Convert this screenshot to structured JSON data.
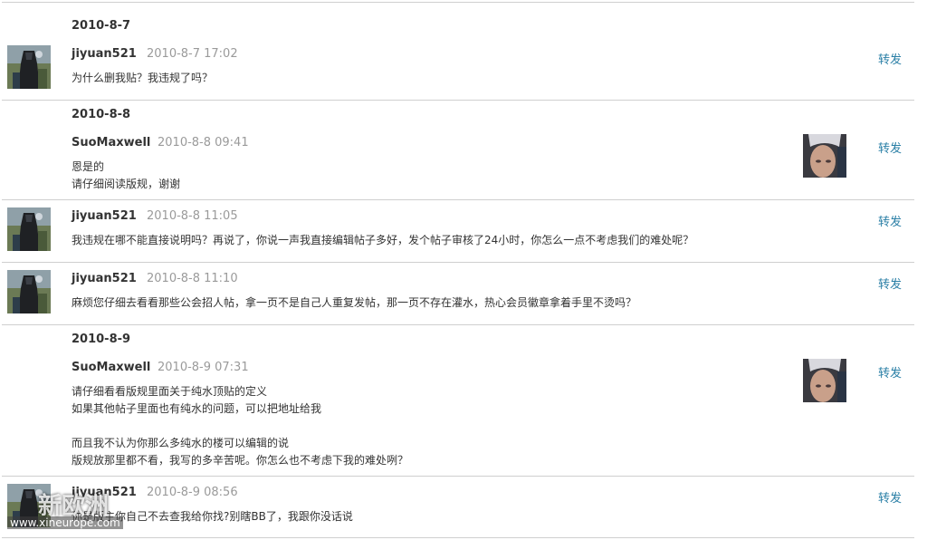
{
  "groups": [
    {
      "date": "2010-8-7",
      "posts": [
        {
          "author": "jiyuan521",
          "time": "2010-8-7 17:02",
          "lines": [
            "为什么删我贴？我违规了吗？"
          ],
          "forward": "转发",
          "side": "left"
        }
      ]
    },
    {
      "date": "2010-8-8",
      "posts": [
        {
          "author": "SuoMaxwell",
          "time": "2010-8-8 09:41",
          "lines": [
            "恩是的",
            "请仔细阅读版规，谢谢"
          ],
          "forward": "转发",
          "side": "right"
        },
        {
          "author": "jiyuan521",
          "time": "2010-8-8 11:05",
          "lines": [
            "我违规在哪不能直接说明吗？再说了，你说一声我直接编辑帖子多好，发个帖子审核了24小时，你怎么一点不考虑我们的难处呢？"
          ],
          "forward": "转发",
          "side": "left"
        },
        {
          "author": "jiyuan521",
          "time": "2010-8-8 11:10",
          "lines": [
            "麻烦您仔细去看看那些公会招人帖，拿一页不是自己人重复发帖，那一页不存在灌水，热心会员徽章拿着手里不烫吗？"
          ],
          "forward": "转发",
          "side": "left"
        }
      ]
    },
    {
      "date": "2010-8-9",
      "posts": [
        {
          "author": "SuoMaxwell",
          "time": "2010-8-9 07:31",
          "lines": [
            "请仔细看看版规里面关于纯水顶贴的定义",
            "如果其他帖子里面也有纯水的问题，可以把地址给我",
            "",
            "而且我不认为你那么多纯水的楼可以编辑的说",
            "版规放那里都不看，我写的多辛苦呢。你怎么也不考虑下我的难处咧？"
          ],
          "forward": "转发",
          "side": "right"
        },
        {
          "author": "jiyuan521",
          "time": "2010-8-9 08:56",
          "lines": [
            "你是版主你自己不去查我给你找?别瞎BB了，我跟你没话说"
          ],
          "forward": "转发",
          "side": "left"
        }
      ]
    }
  ],
  "watermark": {
    "title": "新欧洲",
    "url": "www.xineurope.com"
  },
  "colors": {
    "link": "#2a7fa6",
    "time": "#9a9a9a",
    "rule": "#cfcfcf",
    "text": "#333333"
  },
  "icons": {
    "left_avatar": "knight-avatar",
    "right_avatar": "elf-girl-avatar"
  }
}
